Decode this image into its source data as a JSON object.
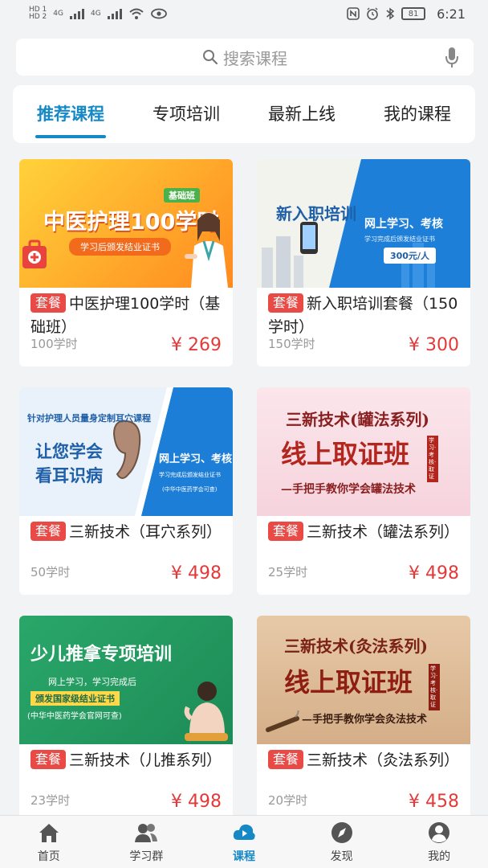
{
  "status_bar": {
    "sim1": "HD 1",
    "sim2": "HD 2",
    "net1": "4G",
    "net2": "4G",
    "battery": "81",
    "time": "6:21"
  },
  "search": {
    "placeholder": "搜索课程"
  },
  "tabs": [
    {
      "label": "推荐课程",
      "active": true
    },
    {
      "label": "专项培训"
    },
    {
      "label": "最新上线"
    },
    {
      "label": "我的课程"
    }
  ],
  "courses": [
    {
      "badge": "套餐",
      "title": "中医护理100学时（基础班）",
      "hours": "100学时",
      "price": "¥ 269",
      "thumb": {
        "headline": "中医护理100学时",
        "tag": "基础班",
        "sub": "学习后颁发结业证书"
      }
    },
    {
      "badge": "套餐",
      "title": "新入职培训套餐（150学时）",
      "hours": "150学时",
      "price": "¥ 300",
      "thumb": {
        "headline": "新入职培训",
        "line1": "网上学习、考核",
        "line2": "学习完成后颁发结业证书",
        "price_tag": "300元/人"
      }
    },
    {
      "badge": "套餐",
      "title": "三新技术（耳穴系列）",
      "hours": "50学时",
      "price": "¥ 498",
      "thumb": {
        "top": "针对护理人员量身定制耳穴课程",
        "line1": "让您学会",
        "line2": "看耳识病",
        "right1": "网上学习、考核",
        "right2": "学习完成后颁发结业证书",
        "right3": "(中华中医药学会可查)"
      }
    },
    {
      "badge": "套餐",
      "title": "三新技术（罐法系列）",
      "hours": "25学时",
      "price": "¥ 498",
      "thumb": {
        "line1": "三新技术(罐法系列)",
        "line2": "线上取证班",
        "line3": "—手把手教你学会罐法技术",
        "seal": "学习·考核·取证"
      }
    },
    {
      "badge": "套餐",
      "title": "三新技术（儿推系列）",
      "hours": "23学时",
      "price": "¥ 498",
      "thumb": {
        "line1": "少儿推拿专项培训",
        "line2": "网上学习，学习完成后",
        "line3": "颁发国家级结业证书",
        "line4": "(中华中医药学会官网可查)"
      }
    },
    {
      "badge": "套餐",
      "title": "三新技术（灸法系列）",
      "hours": "20学时",
      "price": "¥ 458",
      "thumb": {
        "line1": "三新技术(灸法系列)",
        "line2": "线上取证班",
        "line3": "—手把手教你学会灸法技术",
        "seal": "学习·考核·取证"
      }
    }
  ],
  "nav": [
    {
      "label": "首页",
      "icon": "home-icon"
    },
    {
      "label": "学习群",
      "icon": "group-icon"
    },
    {
      "label": "课程",
      "icon": "cloud-icon",
      "active": true
    },
    {
      "label": "发现",
      "icon": "compass-icon"
    },
    {
      "label": "我的",
      "icon": "user-icon"
    }
  ],
  "colors": {
    "accent": "#1589c6",
    "price": "#e23a3a",
    "badge": "#e94a46"
  }
}
